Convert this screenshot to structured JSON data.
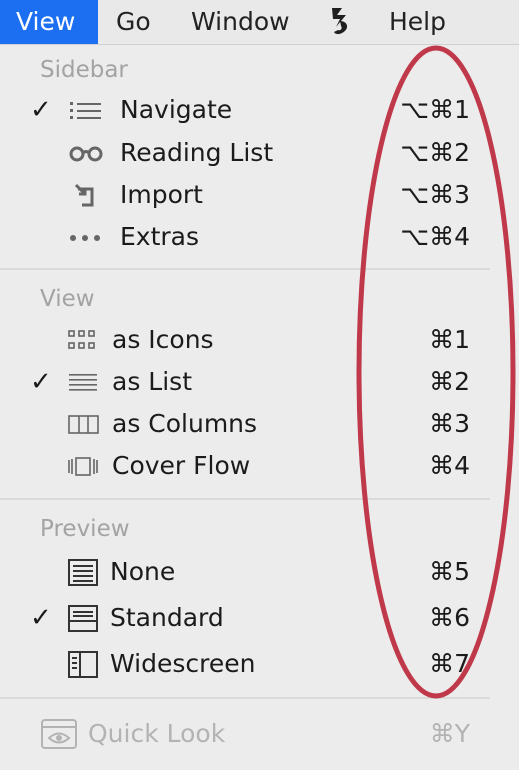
{
  "menubar": {
    "items": [
      {
        "label": "View"
      },
      {
        "label": "Go"
      },
      {
        "label": "Window"
      },
      {
        "label": "Help"
      }
    ],
    "app_icon": "script-app-icon",
    "accent": "#1c6ff0"
  },
  "menu": {
    "sections": [
      {
        "title": "Sidebar",
        "items": [
          {
            "label": "Navigate",
            "shortcut": "⌥⌘1",
            "checked": true,
            "icon": "list-icon"
          },
          {
            "label": "Reading List",
            "shortcut": "⌥⌘2",
            "checked": false,
            "icon": "glasses-icon"
          },
          {
            "label": "Import",
            "shortcut": "⌥⌘3",
            "checked": false,
            "icon": "import-icon"
          },
          {
            "label": "Extras",
            "shortcut": "⌥⌘4",
            "checked": false,
            "icon": "ellipsis-icon"
          }
        ]
      },
      {
        "title": "View",
        "items": [
          {
            "label": "as Icons",
            "shortcut": "⌘1",
            "checked": false,
            "icon": "grid-icon"
          },
          {
            "label": "as List",
            "shortcut": "⌘2",
            "checked": true,
            "icon": "lines-icon"
          },
          {
            "label": "as Columns",
            "shortcut": "⌘3",
            "checked": false,
            "icon": "columns-icon"
          },
          {
            "label": "Cover Flow",
            "shortcut": "⌘4",
            "checked": false,
            "icon": "coverflow-icon"
          }
        ]
      },
      {
        "title": "Preview",
        "items": [
          {
            "label": "None",
            "shortcut": "⌘5",
            "checked": false,
            "icon": "preview-none-icon"
          },
          {
            "label": "Standard",
            "shortcut": "⌘6",
            "checked": true,
            "icon": "preview-standard-icon"
          },
          {
            "label": "Widescreen",
            "shortcut": "⌘7",
            "checked": false,
            "icon": "preview-widescreen-icon"
          }
        ]
      }
    ],
    "quick_look": {
      "label": "Quick Look",
      "shortcut": "⌘Y",
      "enabled": false,
      "icon": "eye-icon"
    },
    "checkmark": "✓"
  },
  "annotation": {
    "color": "#c0394b"
  }
}
